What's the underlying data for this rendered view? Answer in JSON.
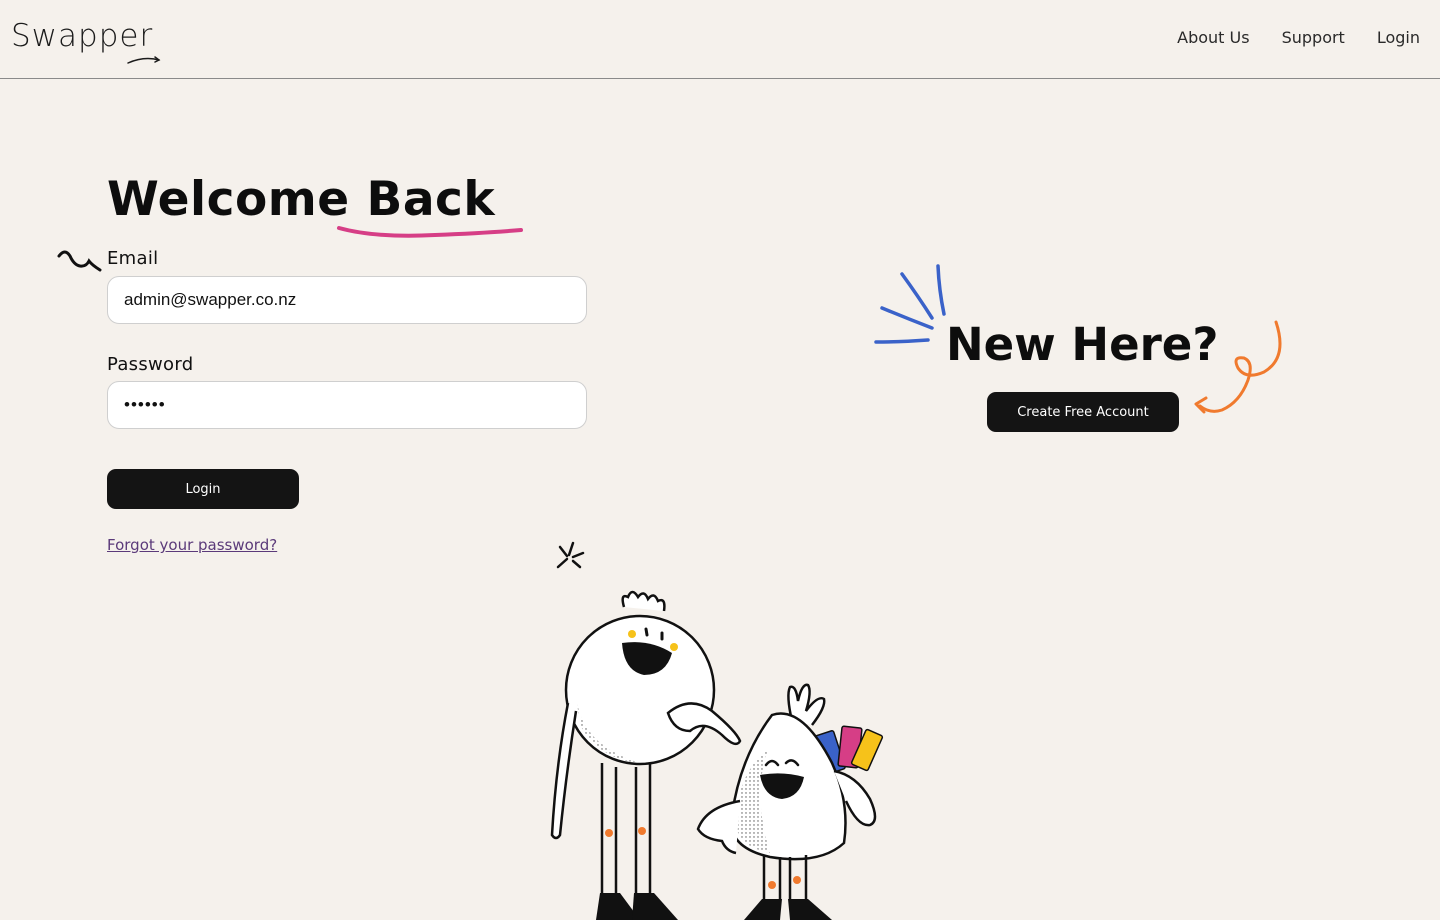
{
  "header": {
    "logo": "Swapper",
    "nav": [
      {
        "label": "About Us"
      },
      {
        "label": "Support"
      },
      {
        "label": "Login"
      }
    ]
  },
  "login": {
    "title": "Welcome Back",
    "email_label": "Email",
    "email_value": "admin@swapper.co.nz",
    "password_label": "Password",
    "password_value": "••••••",
    "login_button": "Login",
    "forgot_link": "Forgot your password?"
  },
  "signup": {
    "title": "New Here?",
    "create_button": "Create Free Account"
  },
  "colors": {
    "accent_pink": "#d63e86",
    "accent_blue": "#3a62c9",
    "accent_orange": "#f07a2e",
    "accent_yellow": "#f6c21a",
    "dark": "#141414",
    "background": "#f5f1ec"
  }
}
